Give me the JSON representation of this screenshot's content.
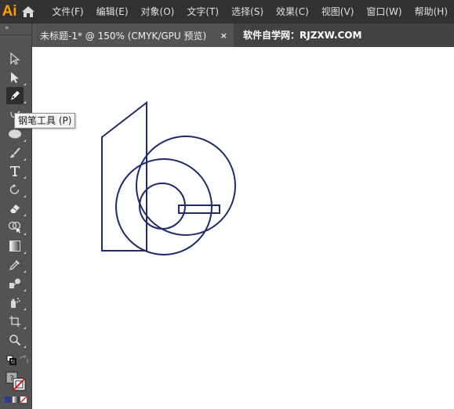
{
  "app": {
    "logo": "Ai"
  },
  "menu": [
    "文件(F)",
    "编辑(E)",
    "对象(O)",
    "文字(T)",
    "选择(S)",
    "效果(C)",
    "视图(V)",
    "窗口(W)",
    "帮助(H)"
  ],
  "tabs": {
    "document": "未标题-1* @ 150% (CMYK/GPU 预览)",
    "close_glyph": "×",
    "site": "软件自学网：RJZXW.COM"
  },
  "toolbar": {
    "collapse": "»",
    "tooltip": "钢笔工具 (P)",
    "tools": [
      "selection-tool",
      "direct-selection-tool",
      "pen-tool",
      "curvature-tool",
      "ellipse-tool",
      "paintbrush-tool",
      "type-tool",
      "rotate-tool",
      "eraser-tool",
      "shape-builder-tool",
      "gradient-tool",
      "eyedropper-tool",
      "blend-tool",
      "symbol-sprayer-tool",
      "artboard-tool",
      "zoom-tool",
      "fill-stroke-swatches",
      "color-mode-buttons"
    ],
    "active_tool": "pen-tool"
  },
  "colors": {
    "stroke": "#1f2a6b",
    "logo": "#ff9a00",
    "menubar_bg": "#323232",
    "panel_bg": "#535353"
  }
}
